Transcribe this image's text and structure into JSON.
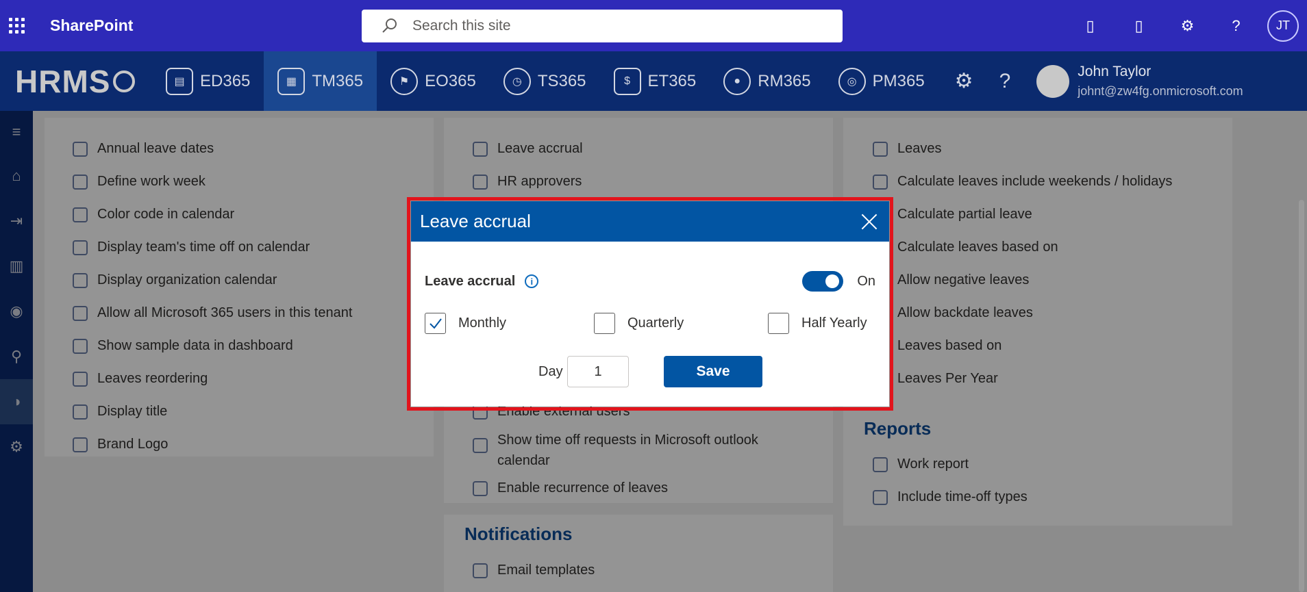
{
  "suitebar": {
    "app_name": "SharePoint",
    "search_placeholder": "Search this site",
    "user_initials": "JT"
  },
  "appbar": {
    "brand": "HRMS",
    "modules": [
      {
        "label": "ED365",
        "icon": "employee-directory-icon"
      },
      {
        "label": "TM365",
        "icon": "calendar-icon",
        "active": true
      },
      {
        "label": "EO365",
        "icon": "onboarding-icon"
      },
      {
        "label": "TS365",
        "icon": "clock-icon"
      },
      {
        "label": "ET365",
        "icon": "expense-icon"
      },
      {
        "label": "RM365",
        "icon": "person-icon"
      },
      {
        "label": "PM365",
        "icon": "performance-icon"
      }
    ],
    "user_name": "John Taylor",
    "user_email": "johnt@zw4fg.onmicrosoft.com"
  },
  "rail": {
    "items": [
      "menu-icon",
      "home-icon",
      "leave-icon",
      "chart-icon",
      "policy-icon",
      "people-settings-icon",
      "time-off-icon",
      "settings-icon"
    ]
  },
  "content": {
    "col1": [
      "Annual leave dates",
      "Define work week",
      "Color code in calendar",
      "Display team's time off on calendar",
      "Display organization calendar",
      "Allow all Microsoft 365 users in this tenant",
      "Show sample data in dashboard",
      "Leaves reordering",
      "Display title",
      "Brand Logo"
    ],
    "col2": [
      "Leave accrual",
      "HR approvers"
    ],
    "col2_lower": [
      "Enable external users",
      "Show time off requests in Microsoft outlook",
      "calendar",
      "Enable recurrence of leaves"
    ],
    "notifications_heading": "Notifications",
    "notifications": [
      "Email templates"
    ],
    "col3": [
      "Leaves",
      "Calculate leaves include weekends / holidays",
      "Calculate partial leave",
      "Calculate leaves based on",
      "Allow negative leaves",
      "Allow backdate leaves",
      "Leaves based on",
      "Leaves Per Year"
    ],
    "reports_heading": "Reports",
    "reports": [
      "Work report",
      "Include time-off types"
    ]
  },
  "dialog": {
    "title": "Leave accrual",
    "accrual_label": "Leave accrual",
    "toggle_state": "On",
    "options": [
      {
        "label": "Monthly",
        "checked": true
      },
      {
        "label": "Quarterly",
        "checked": false
      },
      {
        "label": "Half Yearly",
        "checked": false
      }
    ],
    "day_label": "Day",
    "day_value": "1",
    "save_label": "Save"
  },
  "colors": {
    "suitebar": "#2e2ab8",
    "appbar": "#0b2a6e",
    "dialog_header": "#0255a3",
    "highlight_border": "#e2141c",
    "heading_blue": "#0f4c97"
  }
}
